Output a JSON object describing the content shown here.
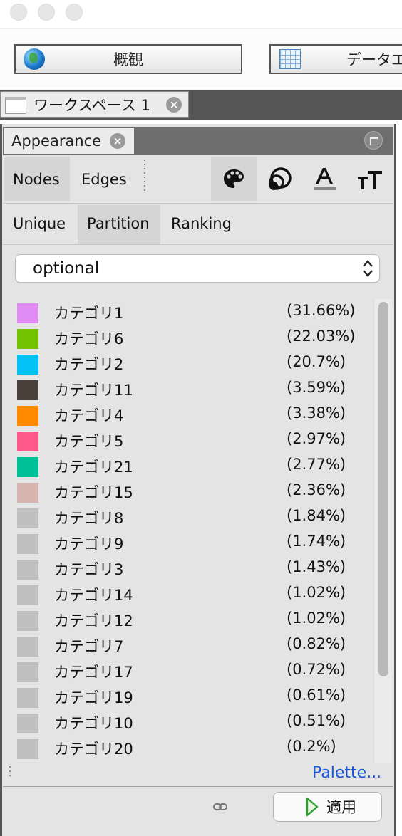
{
  "toolbar": {
    "overview_label": "概観",
    "data_lab_label": "データエ"
  },
  "workspace_tab": {
    "label": "ワークスペース 1"
  },
  "panel": {
    "title": "Appearance",
    "element_tabs": [
      "Nodes",
      "Edges"
    ],
    "mode_tabs": [
      "Unique",
      "Partition",
      "Ranking"
    ],
    "selected_element": "Nodes",
    "selected_mode": "Partition",
    "attribute_dropdown": "optional",
    "palette_link": "Palette...",
    "apply_button": "適用",
    "accent_colors": {
      "link": "#1a56d6",
      "apply_icon": "#2f9e2f"
    }
  },
  "partition": [
    {
      "name": "カテゴリ1",
      "pct": "(31.66%)",
      "color": "#e18cf5"
    },
    {
      "name": "カテゴリ6",
      "pct": "(22.03%)",
      "color": "#74c300"
    },
    {
      "name": "カテゴリ2",
      "pct": "(20.7%)",
      "color": "#05c2f6"
    },
    {
      "name": "カテゴリ11",
      "pct": "(3.59%)",
      "color": "#4a4039"
    },
    {
      "name": "カテゴリ4",
      "pct": "(3.38%)",
      "color": "#ff8a00"
    },
    {
      "name": "カテゴリ5",
      "pct": "(2.97%)",
      "color": "#ff5a8c"
    },
    {
      "name": "カテゴリ21",
      "pct": "(2.77%)",
      "color": "#00c098"
    },
    {
      "name": "カテゴリ15",
      "pct": "(2.36%)",
      "color": "#d6b5b0"
    },
    {
      "name": "カテゴリ8",
      "pct": "(1.84%)",
      "color": "#c0c0c0"
    },
    {
      "name": "カテゴリ9",
      "pct": "(1.74%)",
      "color": "#c0c0c0"
    },
    {
      "name": "カテゴリ3",
      "pct": "(1.43%)",
      "color": "#c0c0c0"
    },
    {
      "name": "カテゴリ14",
      "pct": "(1.02%)",
      "color": "#c0c0c0"
    },
    {
      "name": "カテゴリ12",
      "pct": "(1.02%)",
      "color": "#c0c0c0"
    },
    {
      "name": "カテゴリ7",
      "pct": "(0.82%)",
      "color": "#c0c0c0"
    },
    {
      "name": "カテゴリ17",
      "pct": "(0.72%)",
      "color": "#c0c0c0"
    },
    {
      "name": "カテゴリ19",
      "pct": "(0.61%)",
      "color": "#c0c0c0"
    },
    {
      "name": "カテゴリ10",
      "pct": "(0.51%)",
      "color": "#c0c0c0"
    },
    {
      "name": "カテゴリ20",
      "pct": "(0.2%)",
      "color": "#c0c0c0"
    }
  ],
  "icons": [
    "color-palette-icon",
    "size-icon",
    "label-color-icon",
    "label-size-icon",
    "link-icon",
    "apply-icon",
    "globe-icon",
    "table-icon",
    "document-icon"
  ]
}
